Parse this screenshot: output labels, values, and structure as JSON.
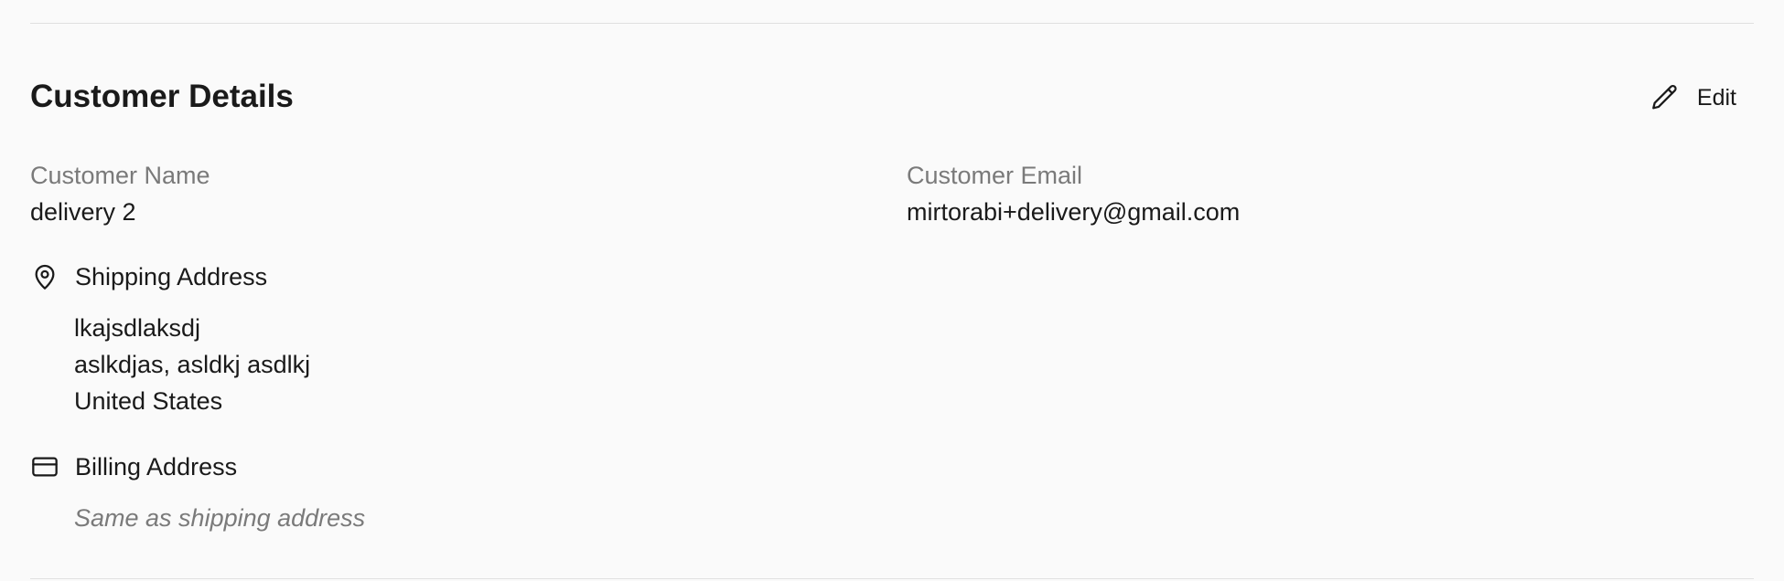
{
  "section": {
    "title": "Customer Details",
    "edit_label": "Edit"
  },
  "customer_name": {
    "label": "Customer Name",
    "value": "delivery 2"
  },
  "customer_email": {
    "label": "Customer Email",
    "value": "mirtorabi+delivery@gmail.com"
  },
  "shipping": {
    "heading": "Shipping Address",
    "icon": "map-pin-icon",
    "lines": [
      "lkajsdlaksdj",
      "aslkdjas, asldkj asdlkj",
      "United States"
    ]
  },
  "billing": {
    "heading": "Billing Address",
    "icon": "credit-card-icon",
    "note": "Same as shipping address"
  },
  "colors": {
    "background": "#fafafa",
    "text": "#1a1a1a",
    "muted": "#7a7a7a",
    "divider": "#e0e0e0"
  }
}
